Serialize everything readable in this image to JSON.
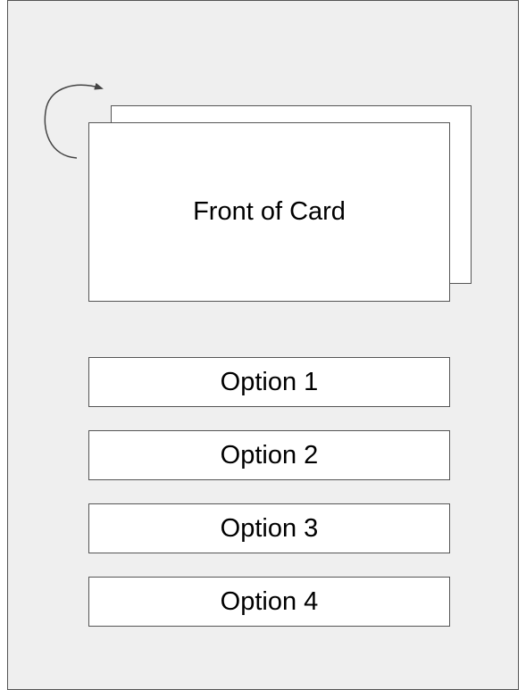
{
  "card": {
    "front_label": "Front of Card"
  },
  "icons": {
    "flip": "flip-card-arrow-icon"
  },
  "options": [
    {
      "label": "Option 1"
    },
    {
      "label": "Option 2"
    },
    {
      "label": "Option 3"
    },
    {
      "label": "Option 4"
    }
  ]
}
